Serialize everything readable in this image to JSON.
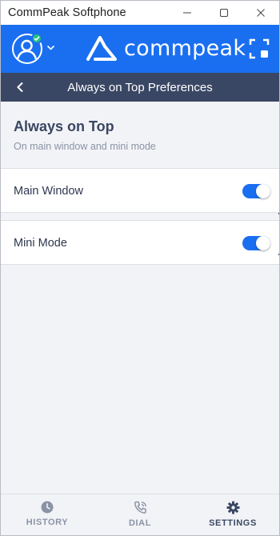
{
  "window": {
    "title": "CommPeak Softphone",
    "controls": [
      "minimize-icon",
      "maximize-icon",
      "close-icon"
    ]
  },
  "header": {
    "brand": "commpeak",
    "brand_color": "#1a6ff0",
    "status_color": "#24c47b",
    "avatar_icon": "user-icon",
    "expand_icon": "expand-icon"
  },
  "subheader": {
    "title": "Always on Top Preferences",
    "back_icon": "chevron-left-icon",
    "color": "#3a4764"
  },
  "section": {
    "title": "Always on Top",
    "subtitle": "On main window and mini mode"
  },
  "settings": [
    {
      "label": "Main Window",
      "enabled": true
    },
    {
      "label": "Mini Mode",
      "enabled": true
    }
  ],
  "bottom_nav": {
    "items": [
      {
        "label": "HISTORY",
        "icon": "clock-icon",
        "active": false
      },
      {
        "label": "DIAL",
        "icon": "phone-icon",
        "active": false
      },
      {
        "label": "SETTINGS",
        "icon": "gear-icon",
        "active": true
      }
    ]
  }
}
